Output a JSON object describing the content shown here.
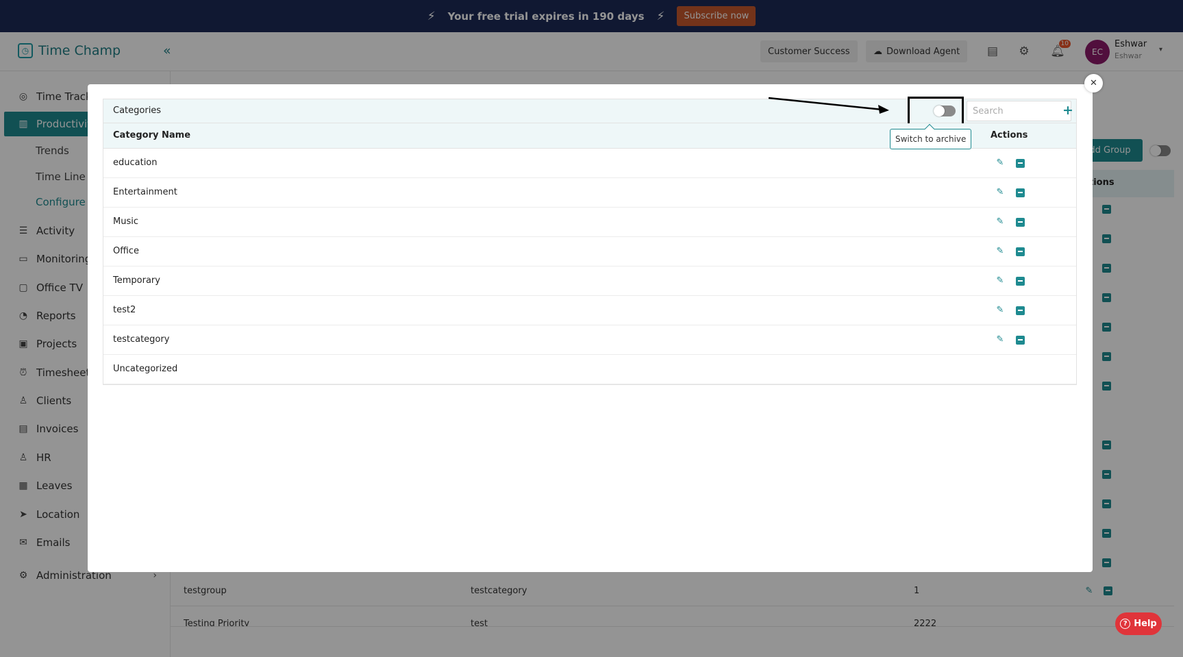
{
  "banner": {
    "text": "Your free trial expires in 190 days",
    "subscribe_label": "Subscribe now"
  },
  "header": {
    "app_name": "Time Champ",
    "customer_success_label": "Customer Success",
    "download_agent_label": "Download Agent",
    "notification_count": "10",
    "user_initials": "EC",
    "user_name": "Eshwar",
    "user_subtitle": "Eshwar"
  },
  "sidebar": {
    "items": [
      {
        "label": "Time Track",
        "icon": "clock-icon"
      },
      {
        "label": "Productivit",
        "icon": "productivity-icon"
      },
      {
        "label": "Activity",
        "icon": "activity-icon"
      },
      {
        "label": "Monitoring",
        "icon": "monitor-icon"
      },
      {
        "label": "Office TV",
        "icon": "tv-icon"
      },
      {
        "label": "Reports",
        "icon": "pie-chart-icon"
      },
      {
        "label": "Projects",
        "icon": "briefcase-icon"
      },
      {
        "label": "Timesheet",
        "icon": "alarm-icon"
      },
      {
        "label": "Clients",
        "icon": "person-icon"
      },
      {
        "label": "Invoices",
        "icon": "invoice-icon"
      },
      {
        "label": "HR",
        "icon": "user-icon"
      },
      {
        "label": "Leaves",
        "icon": "calendar-icon"
      },
      {
        "label": "Location",
        "icon": "location-icon"
      },
      {
        "label": "Emails",
        "icon": "mail-icon"
      },
      {
        "label": "Administration",
        "icon": "gear-icon"
      }
    ],
    "sub_items": [
      "Trends",
      "Time Line",
      "Configure"
    ]
  },
  "background": {
    "add_group_label": "dd Group",
    "actions_header": "tions",
    "rows": [
      {
        "group": "testgroup",
        "category": "testcategory",
        "count": "1"
      },
      {
        "group": "Testing Priority",
        "category": "test",
        "count": "2222"
      }
    ]
  },
  "modal": {
    "panel_title": "Categories",
    "search_placeholder": "Search",
    "add_icon": "plus-icon",
    "tooltip": "Switch to archive",
    "columns": {
      "name": "Category Name",
      "actions": "Actions"
    },
    "categories": [
      {
        "name": "education",
        "has_actions": true
      },
      {
        "name": "Entertainment",
        "has_actions": true
      },
      {
        "name": "Music",
        "has_actions": true
      },
      {
        "name": "Office",
        "has_actions": true
      },
      {
        "name": "Temporary",
        "has_actions": true
      },
      {
        "name": "test2",
        "has_actions": true
      },
      {
        "name": "testcategory",
        "has_actions": true
      },
      {
        "name": "Uncategorized",
        "has_actions": false
      }
    ]
  },
  "help": {
    "label": "Help"
  },
  "colors": {
    "brand": "#1e8a90",
    "banner": "#1c2a57",
    "subscribe": "#c6582d",
    "help": "#e0343a",
    "avatar": "#8c1a6a"
  }
}
